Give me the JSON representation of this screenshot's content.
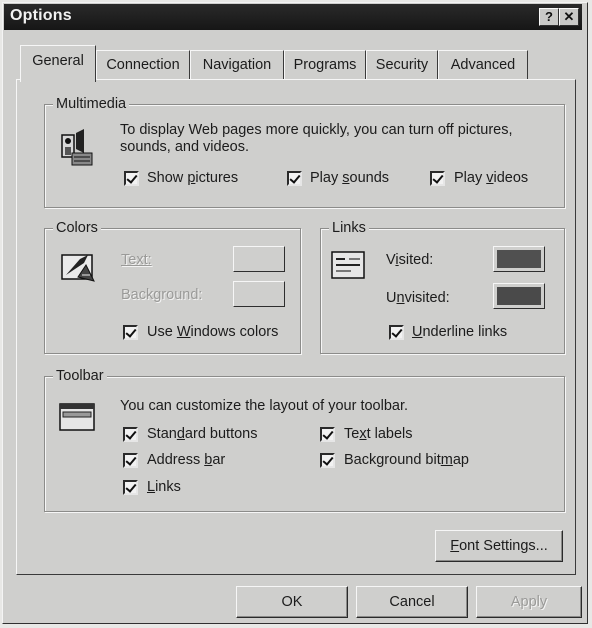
{
  "window": {
    "title": "Options",
    "help_button": "?",
    "close_button": "✕"
  },
  "tabs": [
    {
      "label": "General",
      "active": true
    },
    {
      "label": "Connection",
      "active": false
    },
    {
      "label": "Navigation",
      "active": false
    },
    {
      "label": "Programs",
      "active": false
    },
    {
      "label": "Security",
      "active": false
    },
    {
      "label": "Advanced",
      "active": false
    }
  ],
  "multimedia": {
    "legend": "Multimedia",
    "description": "To display Web pages more quickly, you can turn off pictures, sounds, and videos.",
    "show_pictures": {
      "pre": "Show ",
      "key": "p",
      "post": "ictures",
      "checked": true
    },
    "play_sounds": {
      "pre": "Play ",
      "key": "s",
      "post": "ounds",
      "checked": true
    },
    "play_videos": {
      "pre": "Play ",
      "key": "v",
      "post": "ideos",
      "checked": true
    },
    "icon": "multimedia-icon"
  },
  "colors": {
    "legend": "Colors",
    "text_label": "Text:",
    "background_label": "Background:",
    "use_windows": {
      "pre": "Use ",
      "key": "W",
      "post": "indows colors",
      "checked": true
    },
    "icon": "colors-palette-icon"
  },
  "links": {
    "legend": "Links",
    "visited": {
      "pre": "V",
      "key": "i",
      "post": "sited:"
    },
    "unvisited": {
      "pre": "U",
      "key": "n",
      "post": "visited:"
    },
    "underline": {
      "pre": "",
      "key": "U",
      "post": "nderline links",
      "checked": true
    },
    "visited_color": "#505050",
    "unvisited_color": "#4a4a4a",
    "icon": "links-icon"
  },
  "toolbar": {
    "legend": "Toolbar",
    "description": "You can customize the layout of your toolbar.",
    "standard_buttons": {
      "pre": "Stan",
      "key": "d",
      "post": "ard buttons",
      "checked": true
    },
    "address_bar": {
      "pre": "Address ",
      "key": "b",
      "post": "ar",
      "checked": true
    },
    "links": {
      "pre": "",
      "key": "L",
      "post": "inks",
      "checked": true
    },
    "text_labels": {
      "pre": "Te",
      "key": "x",
      "post": "t labels",
      "checked": true
    },
    "background_bitmap": {
      "pre": "Background bit",
      "key": "m",
      "post": "ap",
      "checked": true
    },
    "icon": "toolbar-window-icon"
  },
  "font_settings": {
    "pre": "",
    "key": "F",
    "post": "ont Settings..."
  },
  "buttons": {
    "ok": "OK",
    "cancel": "Cancel",
    "apply": "Apply"
  }
}
